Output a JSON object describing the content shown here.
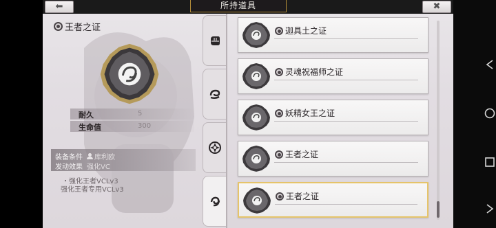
{
  "header": {
    "title": "所持道具",
    "back_icon": "arrow-left-icon",
    "close_icon": "close-icon"
  },
  "detail": {
    "item_name": "王者之证",
    "stats": [
      {
        "label": "耐久",
        "value": "5"
      },
      {
        "label": "生命值",
        "value": "300"
      }
    ],
    "equip_condition_label": "装备条件",
    "equip_condition_value": "库利欧",
    "trigger_effect_label": "发动效果",
    "trigger_effect_value": "强化VC",
    "effects": [
      "・强化王者VCLv3",
      "强化王者专用VCLv3"
    ]
  },
  "tabs": [
    {
      "icon": "fist-icon",
      "active": false
    },
    {
      "icon": "swirl-icon",
      "active": false
    },
    {
      "icon": "flower-icon",
      "active": false
    },
    {
      "icon": "spiral-icon",
      "active": true
    }
  ],
  "items": [
    {
      "name": "迦具土之证",
      "selected": false
    },
    {
      "name": "灵魂祝福师之证",
      "selected": false
    },
    {
      "name": "妖精女王之证",
      "selected": false
    },
    {
      "name": "王者之证",
      "selected": false
    },
    {
      "name": "王者之证",
      "selected": true
    }
  ],
  "colors": {
    "accent_gold": "#e6c46a",
    "title_bar": "#1d1a1c"
  }
}
